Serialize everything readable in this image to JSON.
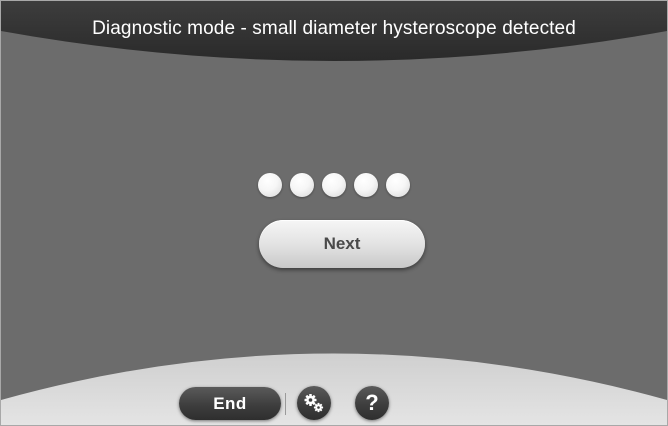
{
  "header": {
    "title": "Diagnostic mode - small diameter hysteroscope detected"
  },
  "progress": {
    "step_count": 5
  },
  "main": {
    "next_label": "Next"
  },
  "footer": {
    "end_label": "End",
    "settings_icon": "gears-icon",
    "help_label": "?"
  },
  "colors": {
    "background": "#6c6c6c",
    "band": "#dcdcdc",
    "dark_button": "#3e3e3e",
    "light_button": "#e2e2e2"
  }
}
